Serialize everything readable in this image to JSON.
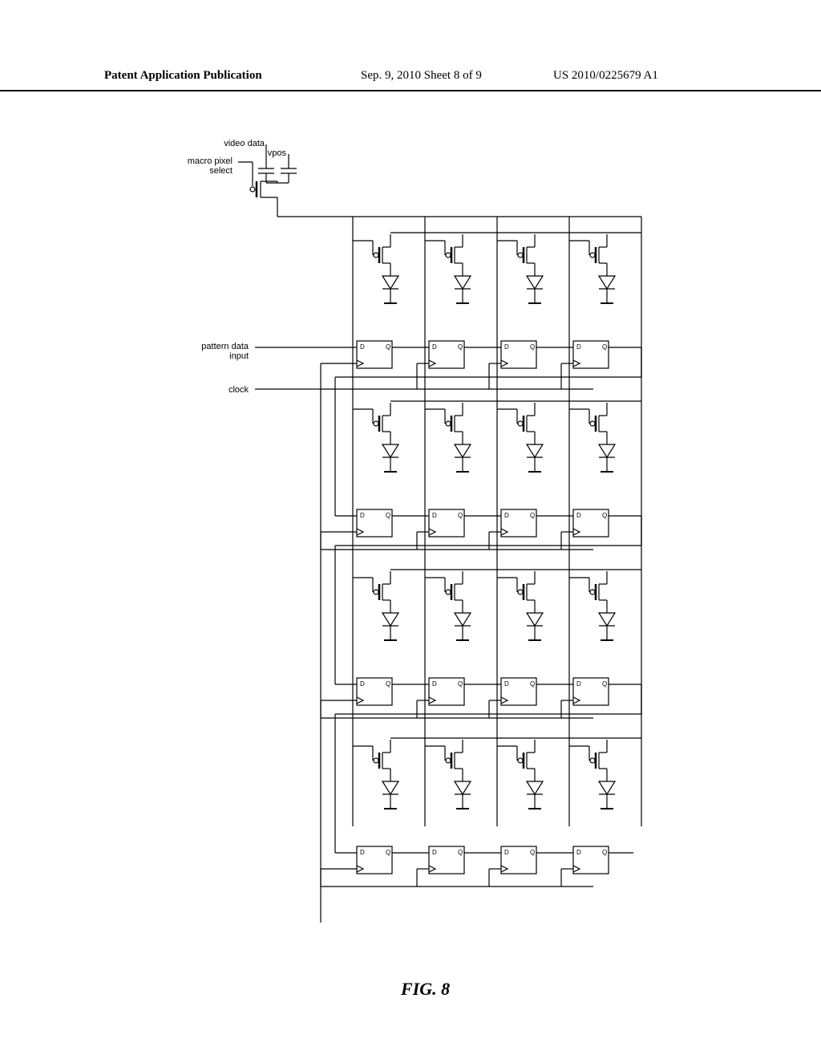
{
  "header": {
    "left": "Patent Application Publication",
    "mid": "Sep. 9, 2010  Sheet 8 of 9",
    "right": "US 2010/0225679 A1"
  },
  "signals": {
    "video_data_l1": "video data",
    "macro_pixel_l1": "macro pixel",
    "macro_pixel_l2": "select",
    "vpos": "vpos",
    "pattern_l1": "pattern data",
    "pattern_l2": "input",
    "clock": "clock"
  },
  "dff": {
    "d": "D",
    "q": "Q"
  },
  "caption": "FIG. 8"
}
